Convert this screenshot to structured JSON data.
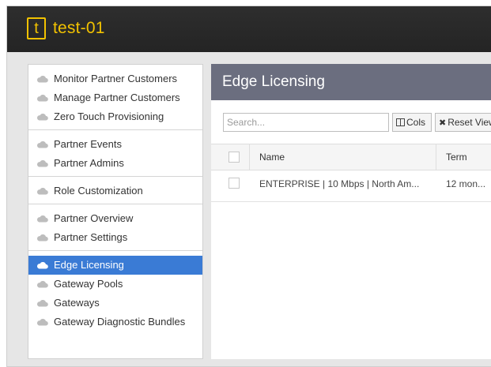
{
  "header": {
    "logo_letter": "t",
    "title": "test-01",
    "accent_color": "#f2c200"
  },
  "sidebar": {
    "groups": [
      {
        "items": [
          {
            "label": "Monitor Partner Customers",
            "icon": "cloud-icon"
          },
          {
            "label": "Manage Partner Customers",
            "icon": "cloud-icon"
          },
          {
            "label": "Zero Touch Provisioning",
            "icon": "cloud-icon"
          }
        ]
      },
      {
        "items": [
          {
            "label": "Partner Events",
            "icon": "cloud-icon"
          },
          {
            "label": "Partner Admins",
            "icon": "cloud-icon"
          }
        ]
      },
      {
        "items": [
          {
            "label": "Role Customization",
            "icon": "cloud-icon"
          }
        ]
      },
      {
        "items": [
          {
            "label": "Partner Overview",
            "icon": "cloud-icon"
          },
          {
            "label": "Partner Settings",
            "icon": "cloud-icon"
          }
        ]
      },
      {
        "items": [
          {
            "label": "Edge Licensing",
            "icon": "cloud-icon",
            "active": true
          },
          {
            "label": "Gateway Pools",
            "icon": "cloud-icon"
          },
          {
            "label": "Gateways",
            "icon": "cloud-icon"
          },
          {
            "label": "Gateway Diagnostic Bundles",
            "icon": "cloud-icon"
          }
        ]
      }
    ],
    "active_color": "#3a7bd5"
  },
  "main": {
    "title": "Edge Licensing",
    "header_color": "#6b6e7f",
    "toolbar": {
      "search_placeholder": "Search...",
      "cols_label": "Cols",
      "reset_label": "Reset View"
    },
    "table": {
      "columns": [
        "Name",
        "Term"
      ],
      "rows": [
        {
          "name": "ENTERPRISE | 10 Mbps | North Am...",
          "term": "12 mon..."
        }
      ]
    }
  }
}
